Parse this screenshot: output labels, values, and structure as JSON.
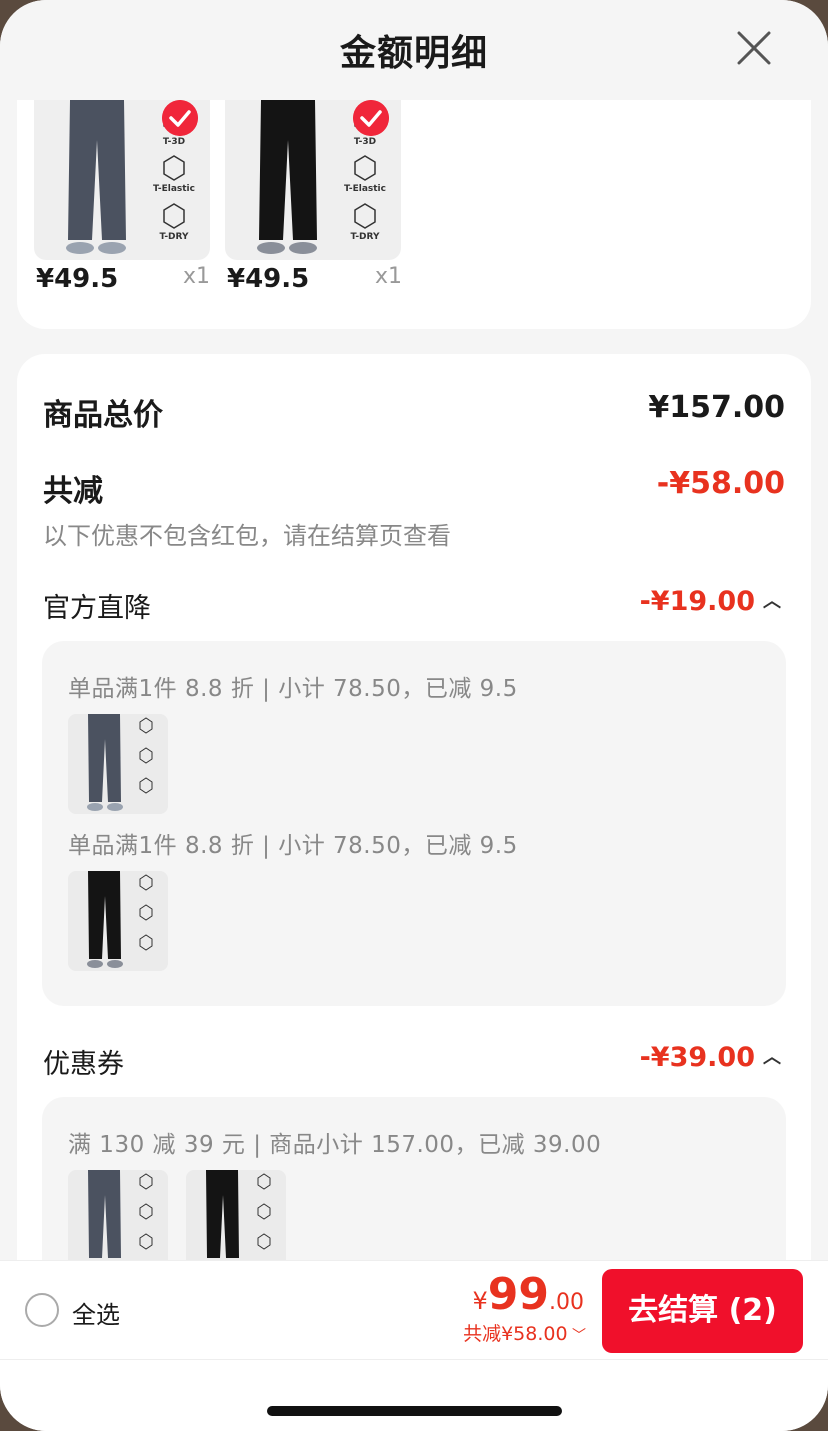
{
  "header": {
    "title": "金额明细"
  },
  "products": [
    {
      "price": "¥49.5",
      "qty": "x1",
      "tags": [
        "T-3D",
        "T-Elastic",
        "T-DRY"
      ],
      "color": "#4b5260"
    },
    {
      "price": "¥49.5",
      "qty": "x1",
      "tags": [
        "T-3D",
        "T-Elastic",
        "T-DRY"
      ],
      "color": "#141414"
    }
  ],
  "summary": {
    "total_label": "商品总价",
    "total_value": "¥157.00",
    "reduce_label": "共减",
    "reduce_value": "-¥58.00",
    "note": "以下优惠不包含红包，请在结算页查看"
  },
  "official": {
    "label": "官方直降",
    "value": "-¥19.00",
    "items": [
      {
        "text": "单品满1件 8.8 折 | 小计 78.50，已减 9.5"
      },
      {
        "text": "单品满1件 8.8 折 | 小计 78.50，已减 9.5"
      }
    ]
  },
  "coupon": {
    "label": "优惠券",
    "value": "-¥39.00",
    "text": "满 130 减 39 元 | 商品小计 157.00，已减 39.00"
  },
  "bottom": {
    "select_all": "全选",
    "currency": "¥",
    "total_int": "99",
    "total_dec": ".00",
    "saved": "共减¥58.00",
    "checkout": "去结算 (2)"
  },
  "colors": {
    "accent": "#f0102b",
    "discount": "#e8321f"
  }
}
